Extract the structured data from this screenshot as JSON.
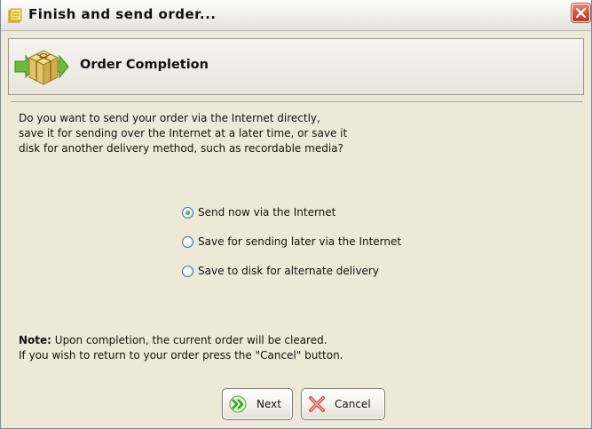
{
  "window": {
    "title": "Finish and send order...",
    "close_icon": "close-icon"
  },
  "header": {
    "title": "Order Completion",
    "icon": "package-icon"
  },
  "question": {
    "lines": [
      "Do you want to send your order via the Internet directly,",
      "save it for sending over the Internet at a later time, or save it",
      "disk for another delivery method, such as recordable media?"
    ]
  },
  "options": [
    {
      "label": "Send now via the Internet",
      "selected": true
    },
    {
      "label": "Save for sending later via the Internet",
      "selected": false
    },
    {
      "label": "Save to disk for alternate delivery",
      "selected": false
    }
  ],
  "note": {
    "prefix": "Note:",
    "line1": " Upon completion, the current order will be cleared.",
    "line2": "If you wish to return to your order press the \"Cancel\" button."
  },
  "buttons": {
    "next_label": "Next",
    "cancel_label": "Cancel"
  },
  "colors": {
    "window_bg": "#ece9d8",
    "close_button": "#d2553f",
    "radio_selected": "#2c8e2c",
    "next_arrow": "#2f9b2f",
    "cancel_x": "#d94a4a"
  }
}
